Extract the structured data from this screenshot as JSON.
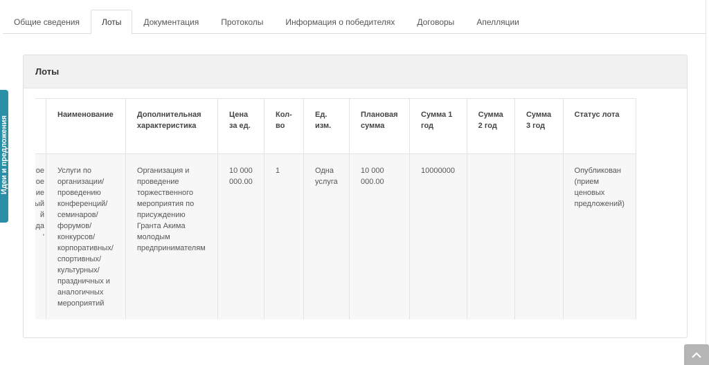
{
  "tabs": [
    {
      "label": "Общие сведения"
    },
    {
      "label": "Лоты",
      "active": true
    },
    {
      "label": "Документация"
    },
    {
      "label": "Протоколы"
    },
    {
      "label": "Информация о победителях"
    },
    {
      "label": "Договоры"
    },
    {
      "label": "Апелляции"
    }
  ],
  "side_tab": {
    "label": "Идеи и предложения"
  },
  "panel": {
    "title": "Лоты"
  },
  "table": {
    "headers": {
      "col0": "",
      "name": "Наименование",
      "extra": "Дополнительная характеристика",
      "price": "Цена за ед.",
      "qty": "Кол-во",
      "unit": "Ед. изм.",
      "planned": "Плановая сумма",
      "sum1": "Сумма 1 год",
      "sum2": "Сумма 2 год",
      "sum3": "Сумма 3 год",
      "status": "Статус лота"
    },
    "row": {
      "col0": "ьное\nвенное\nие\nный\nй\nода\n'",
      "name": "Услуги по организации/ проведению конференций/ семинаров/ форумов/ конкурсов/ корпоративных/ спортивных/ культурных/ праздничных и аналогичных мероприятий",
      "extra": "Организация и проведение торжественного мероприятия по присуждению Гранта Акима молодым предпринимателям",
      "price": "10 000 000.00",
      "qty": "1",
      "unit": "Одна услуга",
      "planned": "10 000 000.00",
      "sum1": "10000000",
      "sum2": "",
      "sum3": "",
      "status": "Опубликован (прием ценовых предложений)"
    }
  },
  "icons": {
    "scroll_top": "chevron-up-icon"
  }
}
